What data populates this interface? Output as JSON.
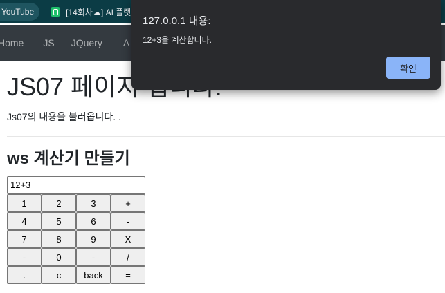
{
  "browser": {
    "bookmarks": [
      {
        "label": "YouTube"
      },
      {
        "label": "[14회차☁] AI 플랫"
      }
    ]
  },
  "navbar": {
    "links": [
      "Home",
      "JS",
      "JQuery",
      "A"
    ]
  },
  "page": {
    "title": "JS07 페이지 입니다.",
    "lead": "Js07의 내용을 불러옵니다. .",
    "calc_title": "ws 계산기 만들기",
    "calc_display": "12+3",
    "keys": [
      [
        "1",
        "2",
        "3",
        "+"
      ],
      [
        "4",
        "5",
        "6",
        "-"
      ],
      [
        "7",
        "8",
        "9",
        "X"
      ],
      [
        "-",
        "0",
        "-",
        "/"
      ],
      [
        ".",
        "c",
        "back",
        "="
      ]
    ]
  },
  "alert": {
    "title": "127.0.0.1 내용:",
    "message": "12+3을 계산합니다.",
    "ok_label": "확인",
    "button_color": "#8ab4f8"
  }
}
